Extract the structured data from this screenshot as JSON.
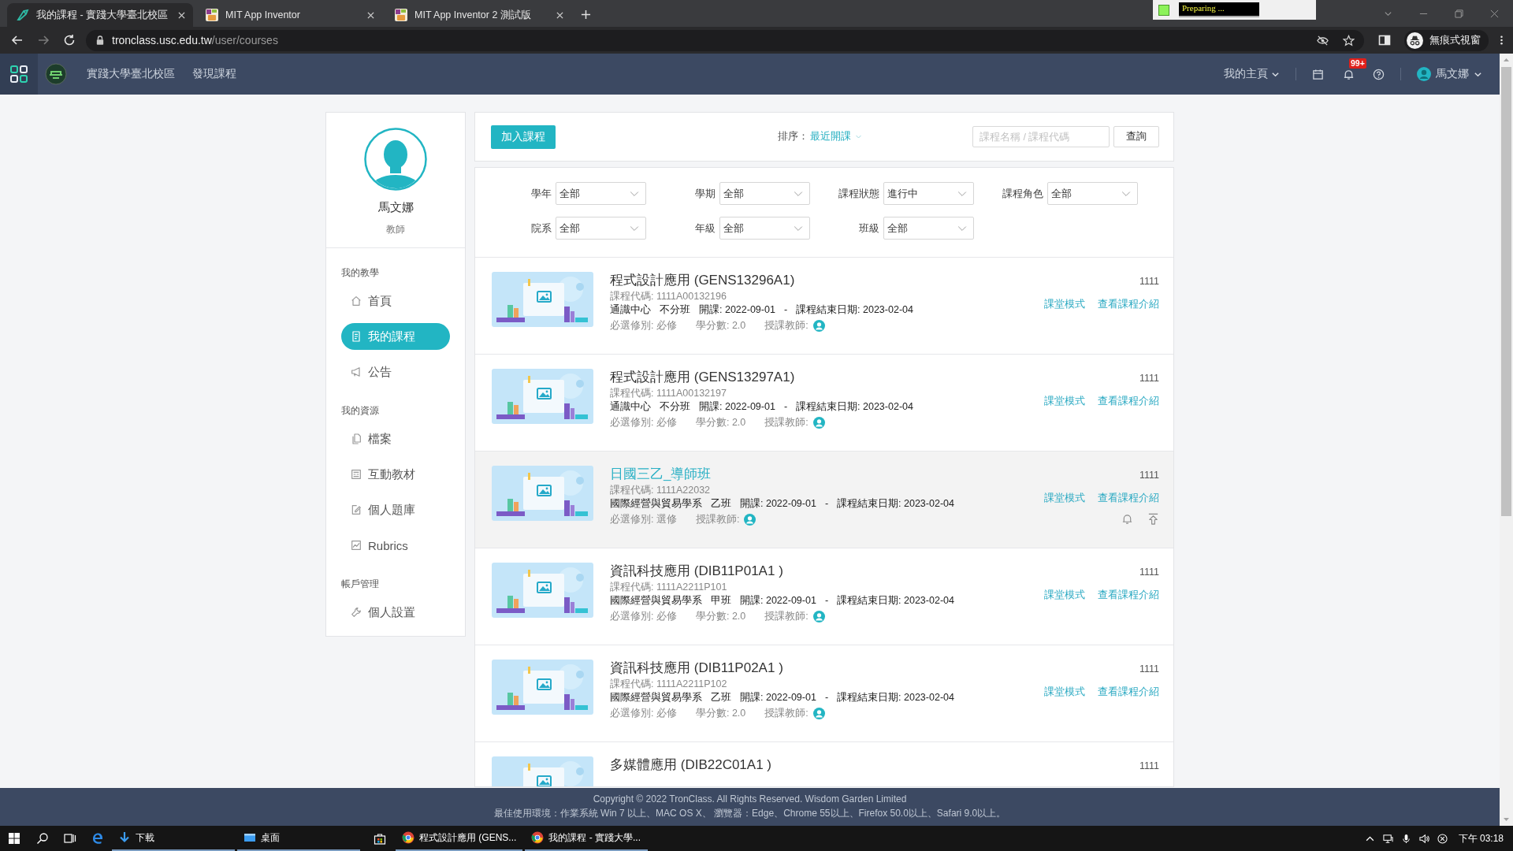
{
  "browser": {
    "tabs": [
      {
        "title": "我的課程 - 實踐大學臺北校區",
        "selected": true
      },
      {
        "title": "MIT App Inventor",
        "selected": false
      },
      {
        "title": "MIT App Inventor 2 測試版",
        "selected": false
      }
    ],
    "recorder_status": "Preparing ...",
    "url_host": "tronclass.usc.edu.tw",
    "url_path": "/user/courses",
    "profile_label": "無痕式視窗"
  },
  "app_header": {
    "nav": [
      "實踐大學臺北校區",
      "發現課程"
    ],
    "home_menu": "我的主頁",
    "notification_badge": "99+",
    "user_name": "馬文娜"
  },
  "sidebar": {
    "user_name": "馬文娜",
    "role": "教師",
    "sections": [
      {
        "title": "我的教學",
        "items": [
          {
            "label": "首頁",
            "selected": false
          },
          {
            "label": "我的課程",
            "selected": true
          },
          {
            "label": "公告",
            "selected": false
          }
        ]
      },
      {
        "title": "我的資源",
        "items": [
          {
            "label": "檔案",
            "selected": false
          },
          {
            "label": "互動教材",
            "selected": false
          },
          {
            "label": "個人題庫",
            "selected": false
          },
          {
            "label": "Rubrics",
            "selected": false
          }
        ]
      },
      {
        "title": "帳戶管理",
        "items": [
          {
            "label": "個人設置",
            "selected": false
          }
        ]
      }
    ]
  },
  "toolbar": {
    "join_button": "加入課程",
    "sort_label": "排序：",
    "sort_value": "最近開課",
    "search_placeholder": "課程名稱 / 課程代碼",
    "search_button": "查詢"
  },
  "filter_rows": [
    [
      {
        "label": "學年",
        "value": "全部"
      },
      {
        "label": "學期",
        "value": "全部"
      },
      {
        "label": "課程狀態",
        "value": "進行中"
      },
      {
        "label": "課程角色",
        "value": "全部"
      }
    ],
    [
      {
        "label": "院系",
        "value": "全部"
      },
      {
        "label": "年級",
        "value": "全部"
      },
      {
        "label": "班級",
        "value": "全部"
      }
    ]
  ],
  "courses": [
    {
      "title": "程式設計應用 (GENS13296A1)",
      "code": "課程代碼: 1111A00132196",
      "department": "通識中心",
      "class": "不分班",
      "start": "開課: 2022-09-01",
      "separator": "-",
      "end": "課程結束日期: 2023-02-04",
      "requirement": "必選修別: 必修",
      "credits": "學分數: 2.0",
      "teacher_label": "授課教師:",
      "semester": "1111",
      "links": [
        "課堂模式",
        "查看課程介紹"
      ],
      "hovered": false
    },
    {
      "title": "程式設計應用 (GENS13297A1)",
      "code": "課程代碼: 1111A00132197",
      "department": "通識中心",
      "class": "不分班",
      "start": "開課: 2022-09-01",
      "separator": "-",
      "end": "課程結束日期: 2023-02-04",
      "requirement": "必選修別: 必修",
      "credits": "學分數: 2.0",
      "teacher_label": "授課教師:",
      "semester": "1111",
      "links": [
        "課堂模式",
        "查看課程介紹"
      ],
      "hovered": false
    },
    {
      "title": "日國三乙_導師班",
      "code": "課程代碼: 1111A22032",
      "department": "國際經營與貿易學系",
      "class": "乙班",
      "start": "開課: 2022-09-01",
      "separator": "-",
      "end": "課程結束日期: 2023-02-04",
      "requirement": "必選修別: 選修",
      "teacher_label": "授課教師:",
      "semester": "1111",
      "links": [
        "課堂模式",
        "查看課程介紹"
      ],
      "hovered": true
    },
    {
      "title": "資訊科技應用 (DIB11P01A1 )",
      "code": "課程代碼: 1111A2211P101",
      "department": "國際經營與貿易學系",
      "class": "甲班",
      "start": "開課: 2022-09-01",
      "separator": "-",
      "end": "課程結束日期: 2023-02-04",
      "requirement": "必選修別: 必修",
      "credits": "學分數: 2.0",
      "teacher_label": "授課教師:",
      "semester": "1111",
      "links": [
        "課堂模式",
        "查看課程介紹"
      ],
      "hovered": false
    },
    {
      "title": "資訊科技應用 (DIB11P02A1 )",
      "code": "課程代碼: 1111A2211P102",
      "department": "國際經營與貿易學系",
      "class": "乙班",
      "start": "開課: 2022-09-01",
      "separator": "-",
      "end": "課程結束日期: 2023-02-04",
      "requirement": "必選修別: 必修",
      "credits": "學分數: 2.0",
      "teacher_label": "授課教師:",
      "semester": "1111",
      "links": [
        "課堂模式",
        "查看課程介紹"
      ],
      "hovered": false
    },
    {
      "title": "多媒體應用 (DIB22C01A1 )",
      "semester": "1111",
      "hovered": false
    }
  ],
  "footer": {
    "copyright": "Copyright © 2022 TronClass. All Rights Reserved. Wisdom Garden Limited",
    "environment": "最佳使用環境：作業系統 Win 7 以上、MAC OS X、 瀏覽器：Edge、Chrome 55以上、Firefox 50.0以上、Safari 9.0以上。"
  },
  "taskbar": {
    "items": [
      {
        "label": "下載"
      },
      {
        "label": "桌面"
      },
      {
        "label": "程式設計應用 (GENS..."
      },
      {
        "label": "我的課程 - 實踐大學..."
      }
    ],
    "clock": "下午 03:18"
  }
}
